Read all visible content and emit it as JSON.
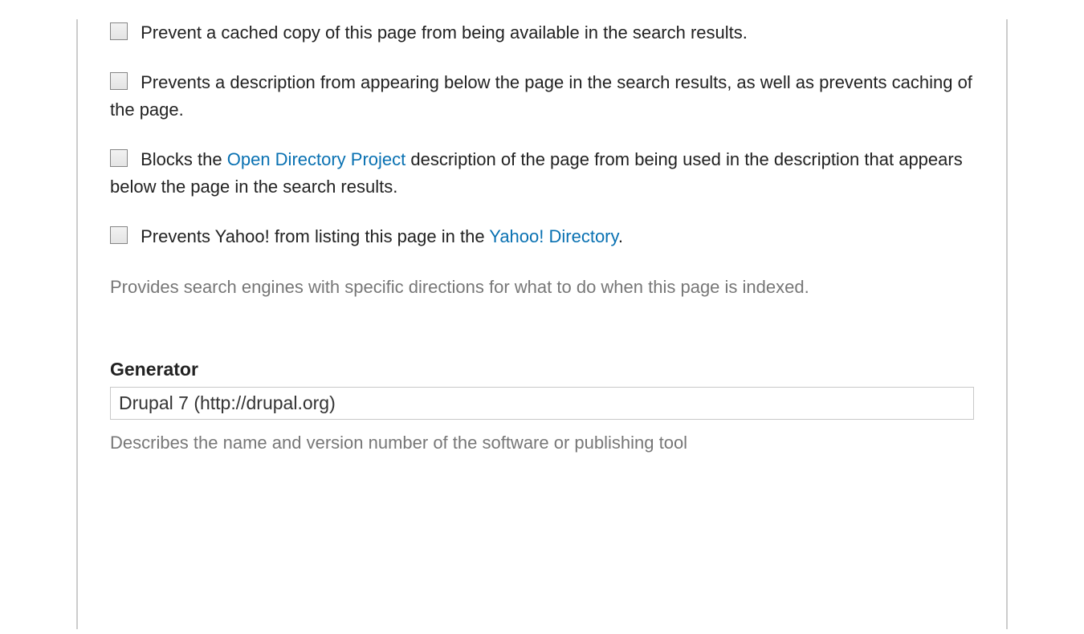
{
  "options": [
    {
      "label_pre": "Prevent a cached copy of this page from being available in the search results.",
      "link": "",
      "label_post": ""
    },
    {
      "label_pre": "Prevents a description from appearing below the page in the search results, as well as prevents caching of the page.",
      "link": "",
      "label_post": ""
    },
    {
      "label_pre": "Blocks the ",
      "link": "Open Directory Project",
      "label_post": " description of the page from being used in the description that appears below the page in the search results."
    },
    {
      "label_pre": "Prevents Yahoo! from listing this page in the ",
      "link": "Yahoo! Directory",
      "label_post": "."
    }
  ],
  "options_help": "Provides search engines with specific directions for what to do when this page is indexed.",
  "generator": {
    "label": "Generator",
    "value": "Drupal 7 (http://drupal.org)",
    "help": "Describes the name and version number of the software or publishing tool"
  }
}
